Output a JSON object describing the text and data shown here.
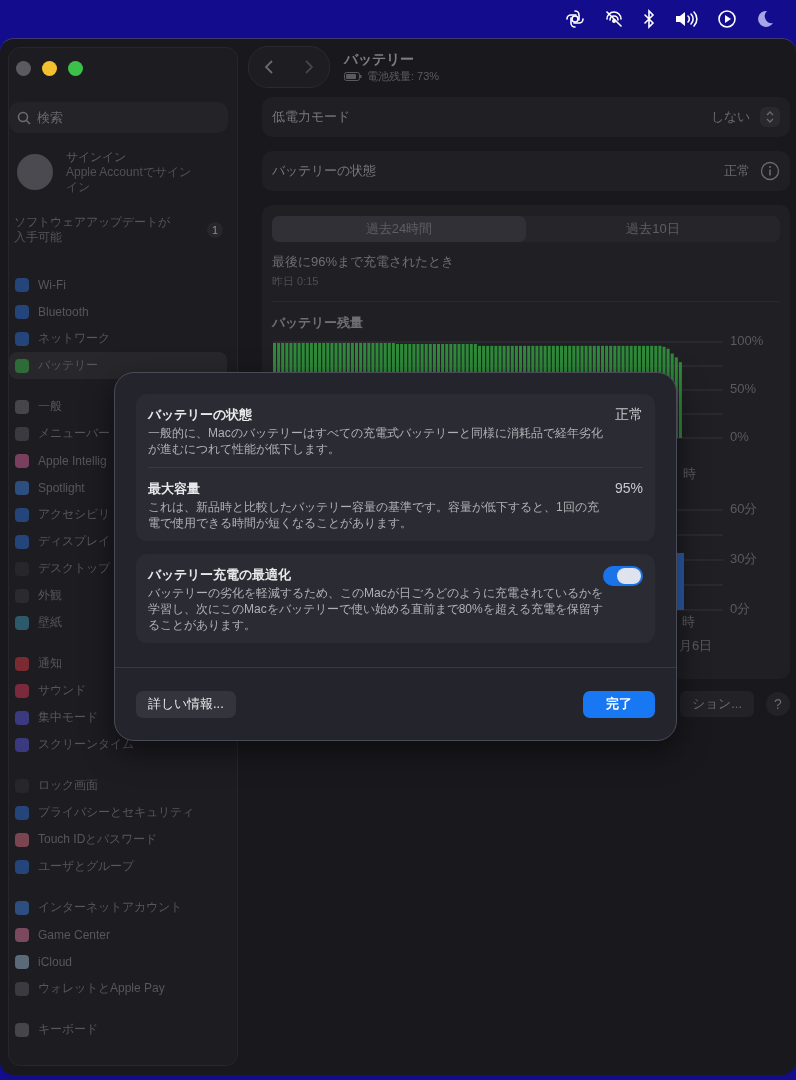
{
  "window": {
    "title": "バッテリー",
    "subtitle": "電池残量: 73%"
  },
  "sidebar": {
    "search": {
      "placeholder": "検索"
    },
    "account": {
      "title": "サインイン",
      "subtitle": "Apple Accountでサインイン"
    },
    "update": {
      "label": "ソフトウェアアップデートが入手可能",
      "badge": "1"
    },
    "groups": [
      [
        {
          "label": "Wi-Fi",
          "selected": false,
          "color": "#24457a"
        },
        {
          "label": "Bluetooth",
          "selected": false,
          "color": "#24457a"
        },
        {
          "label": "ネットワーク",
          "selected": false,
          "color": "#24457a"
        },
        {
          "label": "バッテリー",
          "selected": true,
          "color": "#2f6b36"
        }
      ],
      [
        {
          "label": "一般",
          "selected": false,
          "color": "#45454a"
        },
        {
          "label": "メニューバー",
          "selected": false,
          "color": "#3a3a40"
        },
        {
          "label": "Apple Intellig",
          "selected": false,
          "color": "#7a3f5c"
        },
        {
          "label": "Spotlight",
          "selected": false,
          "color": "#2c4f80"
        },
        {
          "label": "アクセシビリ",
          "selected": false,
          "color": "#24457a"
        },
        {
          "label": "ディスプレイ",
          "selected": false,
          "color": "#24457a"
        },
        {
          "label": "デスクトップ",
          "selected": false,
          "color": "#26262b"
        },
        {
          "label": "外観",
          "selected": false,
          "color": "#2a2a2f"
        },
        {
          "label": "壁紙",
          "selected": false,
          "color": "#2c5a6a"
        }
      ],
      [
        {
          "label": "通知",
          "selected": false,
          "color": "#7a2a30"
        },
        {
          "label": "サウンド",
          "selected": false,
          "color": "#7a2a3a"
        },
        {
          "label": "集中モード",
          "selected": false,
          "color": "#3b3a80"
        },
        {
          "label": "スクリーンタイム",
          "selected": false,
          "color": "#3b3a80"
        }
      ],
      [
        {
          "label": "ロック画面",
          "selected": false,
          "color": "#26262b"
        },
        {
          "label": "プライバシーとセキュリティ",
          "selected": false,
          "color": "#24457a"
        },
        {
          "label": "Touch IDとパスワード",
          "selected": false,
          "color": "#7a4450"
        },
        {
          "label": "ユーザとグループ",
          "selected": false,
          "color": "#24457a"
        }
      ],
      [
        {
          "label": "インターネットアカウント",
          "selected": false,
          "color": "#2c4f80"
        },
        {
          "label": "Game Center",
          "selected": false,
          "color": "#7a4a5c"
        },
        {
          "label": "iCloud",
          "selected": false,
          "color": "#5a6a78"
        },
        {
          "label": "ウォレットとApple Pay",
          "selected": false,
          "color": "#3a3a40"
        }
      ],
      [
        {
          "label": "キーボード",
          "selected": false,
          "color": "#45454a"
        }
      ]
    ]
  },
  "main": {
    "low_power": {
      "label": "低電力モード",
      "value": "しない"
    },
    "health": {
      "label": "バッテリーの状態",
      "value": "正常"
    },
    "range_tabs": [
      {
        "label": "過去24時間",
        "selected": true
      },
      {
        "label": "過去10日",
        "selected": false
      }
    ],
    "last_charge": {
      "title": "最後に96%まで充電されたとき",
      "time": "昨日 0:15"
    },
    "level_chart": {
      "title": "バッテリー残量",
      "y_labels": [
        "100%",
        "50%",
        "0%"
      ],
      "x_labels": [
        "時"
      ]
    },
    "usage_chart": {
      "y_labels": [
        "60分",
        "30分",
        "0分"
      ],
      "x_labels": [
        "時",
        "月6日"
      ]
    },
    "buttons": [
      {
        "label": "ション...",
        "kind": "text"
      },
      {
        "label": "?",
        "kind": "help"
      }
    ]
  },
  "sheet": {
    "sections": [
      {
        "rows": [
          {
            "kind": "value",
            "title": "バッテリーの状態",
            "value": "正常",
            "description": "一般的に、Macのバッテリーはすべての充電式バッテリーと同様に消耗品で経年劣化が進むにつれて性能が低下します。"
          },
          {
            "kind": "value",
            "title": "最大容量",
            "value": "95%",
            "description": "これは、新品時と比較したバッテリー容量の基準です。容量が低下すると、1回の充電で使用できる時間が短くなることがあります。"
          }
        ]
      },
      {
        "rows": [
          {
            "kind": "toggle",
            "title": "バッテリー充電の最適化",
            "on": true,
            "description": "バッテリーの劣化を軽減するため、このMacが日ごろどのように充電されているかを学習し、次にこのMacをバッテリーで使い始める直前まで80%を超える充電を保留することがあります。"
          }
        ]
      }
    ],
    "buttons": [
      {
        "label": "詳しい情報...",
        "kind": "secondary"
      },
      {
        "label": "完了",
        "kind": "primary"
      }
    ]
  }
}
